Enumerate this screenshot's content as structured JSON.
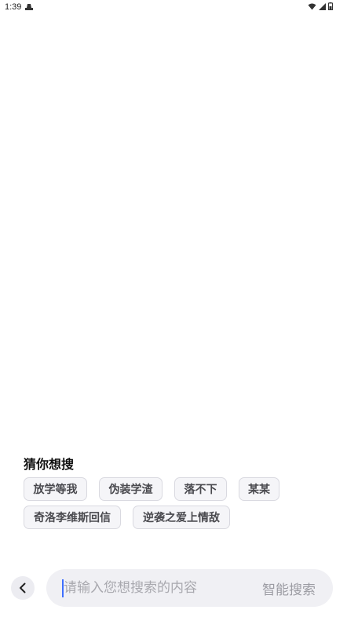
{
  "status_bar": {
    "time": "1:39"
  },
  "suggestions": {
    "title": "猜你想搜",
    "items": [
      "放学等我",
      "伪装学渣",
      "落不下",
      "某某",
      "奇洛李维斯回信",
      "逆袭之爱上情敌"
    ]
  },
  "search": {
    "placeholder": "请输入您想搜索的内容",
    "value": "",
    "smart_search_label": "智能搜索"
  },
  "colors": {
    "caret": "#3f6fff",
    "chip_bg": "#f5f5f8",
    "search_bg": "#f0f0f4"
  },
  "icons": {
    "status_left": "notification-icon",
    "status_right": [
      "wifi-icon",
      "signal-icon",
      "battery-icon"
    ],
    "back": "chevron-left-icon"
  }
}
